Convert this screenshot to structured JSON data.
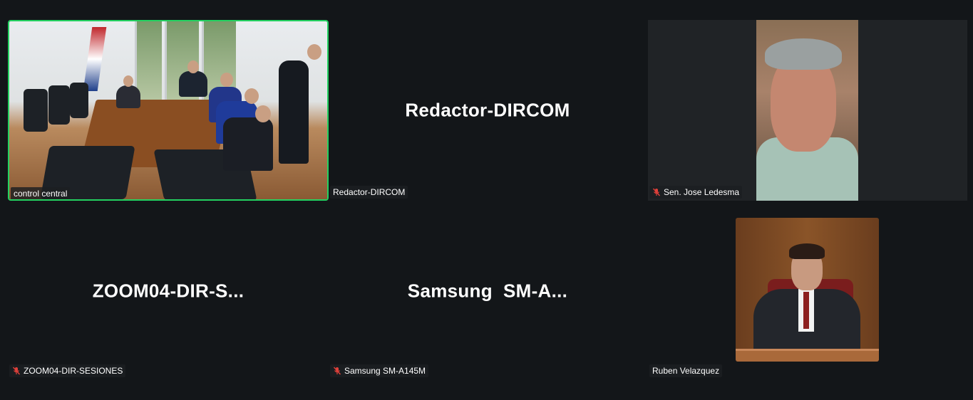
{
  "tiles": [
    {
      "display_name": "",
      "label": "control central",
      "muted": false,
      "active_speaker": true,
      "has_video": true
    },
    {
      "display_name": "Redactor-DIRCOM",
      "label": "Redactor-DIRCOM",
      "muted": false,
      "active_speaker": false,
      "has_video": false
    },
    {
      "display_name": "",
      "label": "Sen. Jose Ledesma",
      "muted": true,
      "active_speaker": false,
      "has_video": true
    },
    {
      "display_name": "ZOOM04-DIR-S...",
      "label": "ZOOM04-DIR-SESIONES",
      "muted": true,
      "active_speaker": false,
      "has_video": false
    },
    {
      "display_name": "Samsung  SM-A...",
      "label": "Samsung SM-A145M",
      "muted": true,
      "active_speaker": false,
      "has_video": false
    },
    {
      "display_name": "",
      "label": "Ruben Velazquez",
      "muted": false,
      "active_speaker": false,
      "has_video": true
    }
  ],
  "colors": {
    "background": "#131619",
    "active_border": "#23d160",
    "mute_icon": "#e0403a",
    "text": "#ffffff"
  },
  "icons": {
    "muted": "mic-off-icon"
  }
}
